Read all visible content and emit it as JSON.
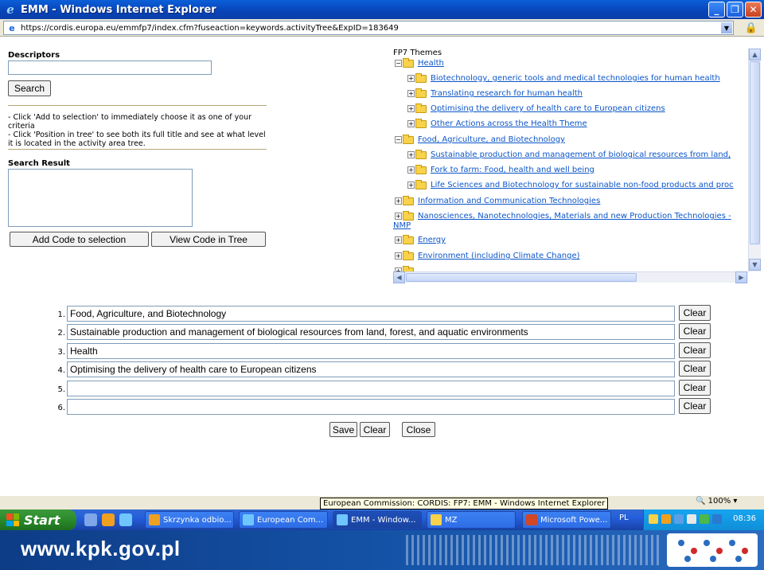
{
  "window": {
    "title": "EMM - Windows Internet Explorer",
    "url": "https://cordis.europa.eu/emmfp7/index.cfm?fuseaction=keywords.activityTree&ExpID=183649"
  },
  "left": {
    "descriptors_label": "Descriptors",
    "search_button": "Search",
    "help_text": "- Click 'Add to selection' to immediately choose it as one of your criteria\n- Click 'Position in tree' to see both its full title and see at what level it is located in the activity area tree.",
    "search_result_label": "Search Result",
    "add_button": "Add Code to selection",
    "view_button": "View Code in Tree"
  },
  "tree": {
    "title": "FP7 Themes",
    "nodes": [
      "Health",
      "Biotechnology, generic tools and medical technologies for human health",
      "Translating research for human health",
      "Optimising the delivery of health care to European citizens",
      "Other Actions across the Health Theme",
      "Food, Agriculture, and Biotechnology",
      "Sustainable production and management of biological resources from land,",
      "Fork to farm: Food, health and well being",
      "Life Sciences and Biotechnology for sustainable non-food products and proc",
      "Information and Communication Technologies",
      "Nanosciences, Nanotechnologies, Materials and new Production Technologies -",
      "NMP",
      "Energy",
      "Environment (including Climate Change)"
    ]
  },
  "selection": {
    "numbers": [
      "1.",
      "2.",
      "3.",
      "4.",
      "5.",
      "6."
    ],
    "values": [
      "Food, Agriculture, and Biotechnology",
      "Sustainable production and management of biological resources from land, forest, and aquatic environments",
      "Health",
      "Optimising the delivery of health care to European citizens",
      "",
      ""
    ],
    "clear_label": "Clear"
  },
  "actions": {
    "save": "Save",
    "clear": "Clear",
    "close": "Close"
  },
  "status": {
    "tooltip": "European Commission: CORDIS: FP7: EMM - Windows Internet Explorer",
    "zoom": "100%"
  },
  "taskbar": {
    "start": "Start",
    "tasks": [
      "Skrzynka odbio...",
      "European Com...",
      "EMM - Window...",
      "MZ",
      "Microsoft Powe..."
    ],
    "lang": "PL",
    "clock": "08:36"
  },
  "footer": {
    "site": "www.kpk.gov.pl"
  },
  "colors": {
    "link": "#0b55c8",
    "titlebar": "#0a5fd8",
    "taskbar": "#245edb",
    "start": "#2b8a2b"
  }
}
